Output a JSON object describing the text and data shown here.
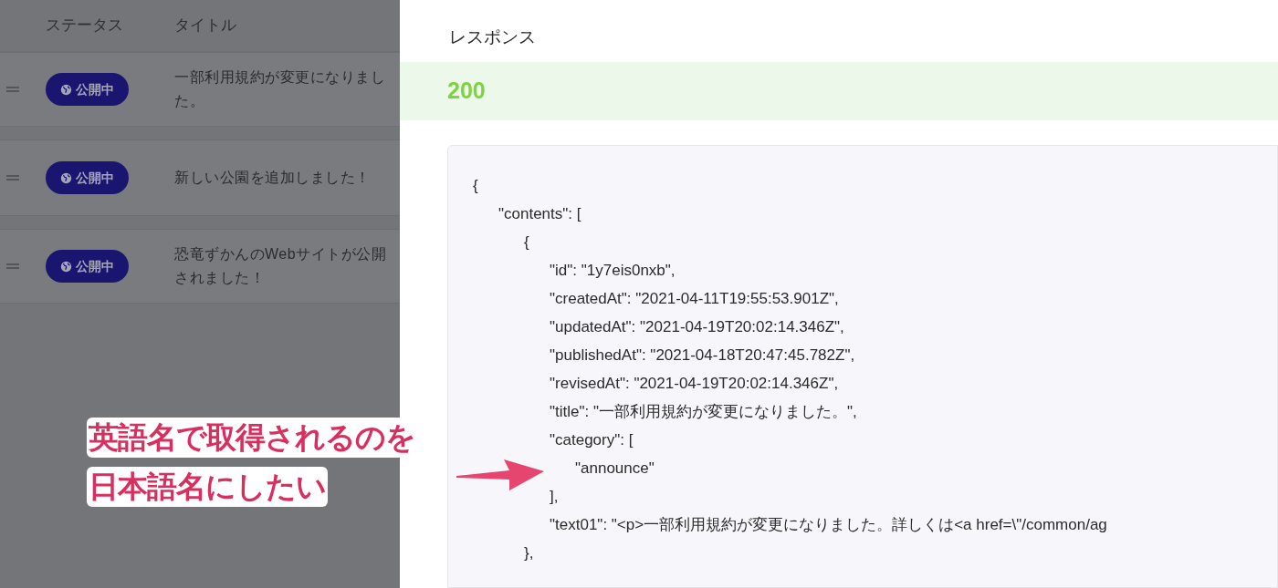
{
  "list": {
    "columns": [
      "ステータス",
      "タイトル"
    ],
    "rows": [
      {
        "status": "公開中",
        "title": "一部利用規約が変更になりました。"
      },
      {
        "status": "公開中",
        "title": "新しい公園を追加しました！"
      },
      {
        "status": "公開中",
        "title": "恐竜ずかんのWebサイトが公開されました！"
      }
    ]
  },
  "response": {
    "heading": "レスポンス",
    "status_code": "200",
    "body": [
      {
        "text": "{",
        "children": [
          {
            "text": "\"contents\": [",
            "children": [
              {
                "text": "{",
                "children": [
                  {
                    "text": "\"id\": \"1y7eis0nxb\","
                  },
                  {
                    "text": "\"createdAt\": \"2021-04-11T19:55:53.901Z\","
                  },
                  {
                    "text": "\"updatedAt\": \"2021-04-19T20:02:14.346Z\","
                  },
                  {
                    "text": "\"publishedAt\": \"2021-04-18T20:47:45.782Z\","
                  },
                  {
                    "text": "\"revisedAt\": \"2021-04-19T20:02:14.346Z\","
                  },
                  {
                    "text": "\"title\": \"一部利用規約が変更になりました。\","
                  },
                  {
                    "text": "\"category\": [",
                    "children": [
                      {
                        "text": "\"announce\""
                      }
                    ]
                  },
                  {
                    "text": "],"
                  },
                  {
                    "text": "\"text01\": \"<p>一部利用規約が変更になりました。詳しくは<a href=\\\"/common/ag"
                  }
                ]
              },
              {
                "text": "},"
              }
            ]
          }
        ]
      }
    ]
  },
  "annotation": {
    "lines": [
      "英語名で取得されるのを",
      "日本語名にしたい"
    ]
  }
}
